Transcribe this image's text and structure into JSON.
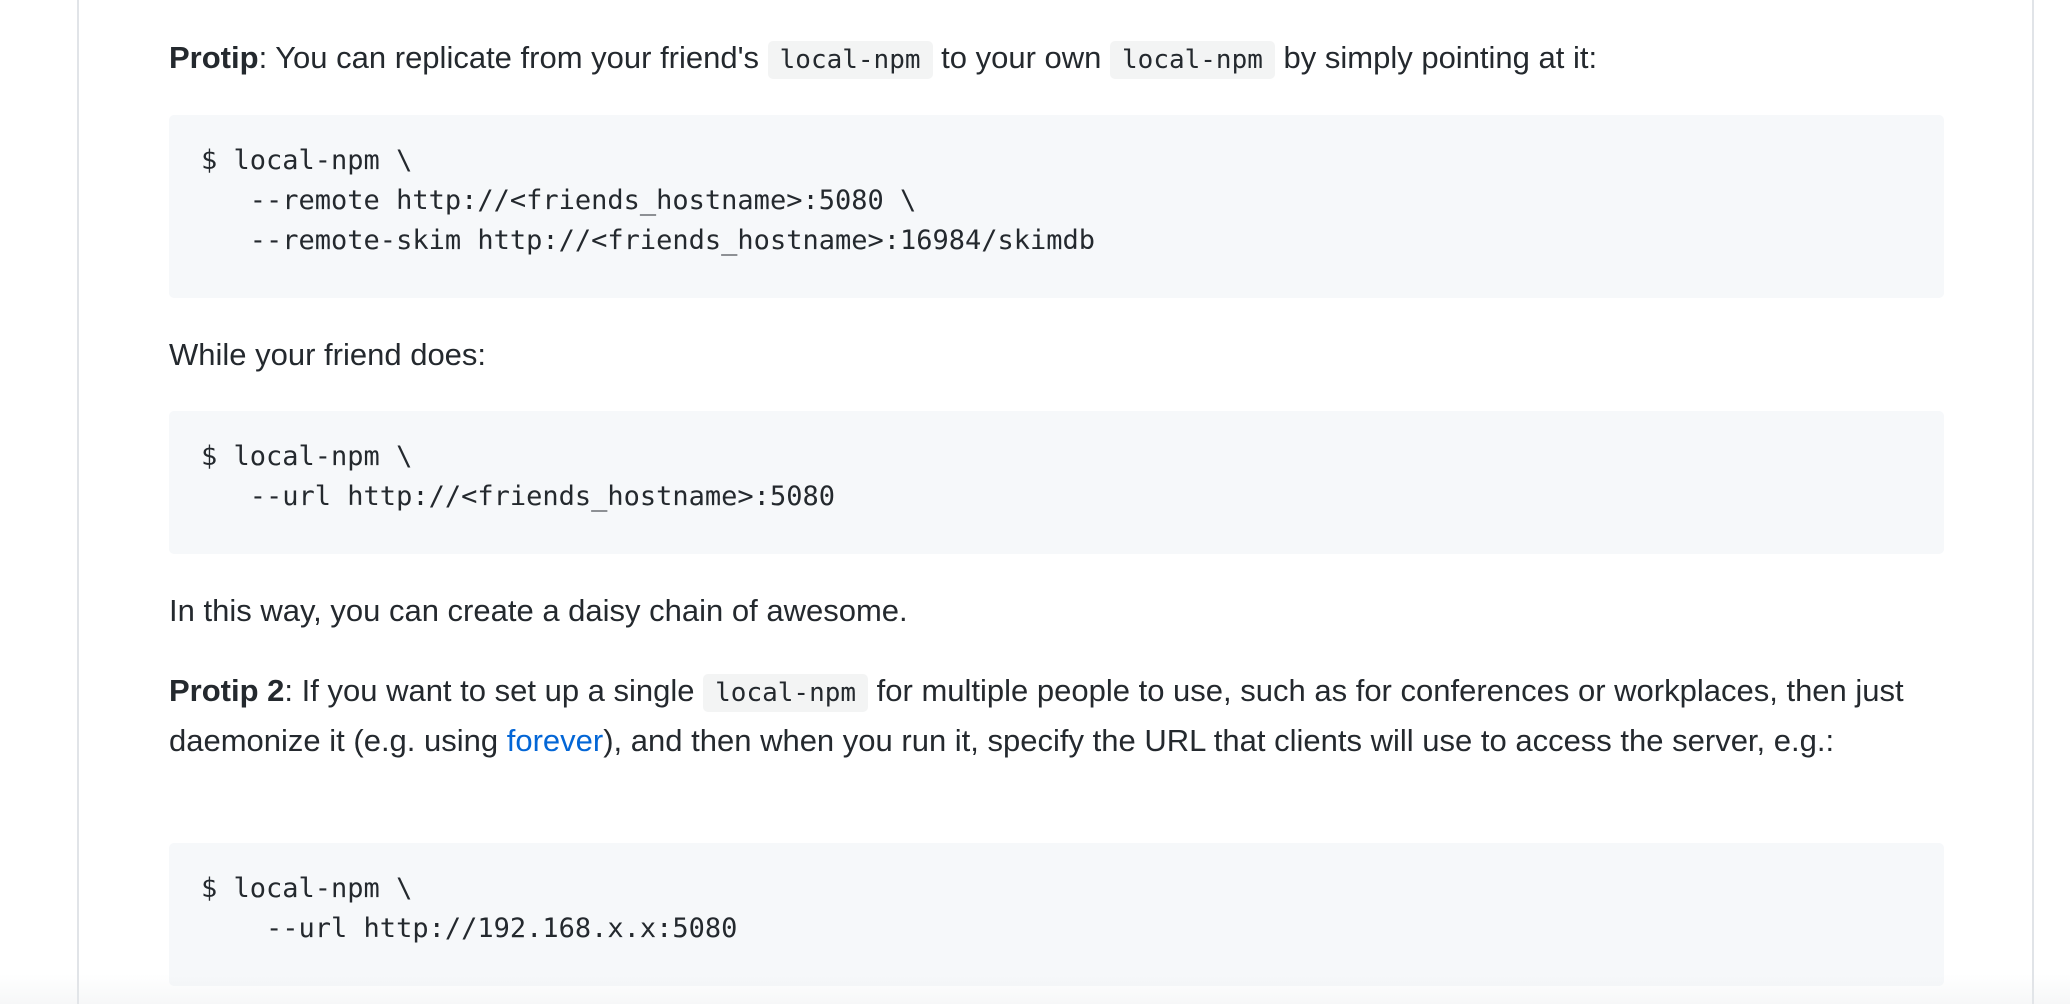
{
  "protip1": {
    "label": "Protip",
    "text_a": ": You can replicate from your friend's ",
    "code_a": "local-npm",
    "text_b": " to your own ",
    "code_b": "local-npm",
    "text_c": " by simply pointing at it:"
  },
  "code1": {
    "lines": [
      "$ local-npm \\",
      "   --remote http://<friends_hostname>:5080 \\",
      "   --remote-skim http://<friends_hostname>:16984/skimdb"
    ]
  },
  "friend_text": "While your friend does:",
  "code2": {
    "lines": [
      "$ local-npm \\",
      "   --url http://<friends_hostname>:5080"
    ]
  },
  "daisy_text": "In this way, you can create a daisy chain of awesome.",
  "protip2": {
    "label": "Protip 2",
    "text_a": ": If you want to set up a single ",
    "code_a": "local-npm",
    "text_b": " for multiple people to use, such as for conferences or workplaces, then just daemonize it (e.g. using ",
    "link": "forever",
    "text_c": "), and then when you run it, specify the URL that clients will use to access the server, e.g.:"
  },
  "code3": {
    "lines": [
      "$ local-npm \\",
      "    --url http://192.168.x.x:5080"
    ]
  }
}
